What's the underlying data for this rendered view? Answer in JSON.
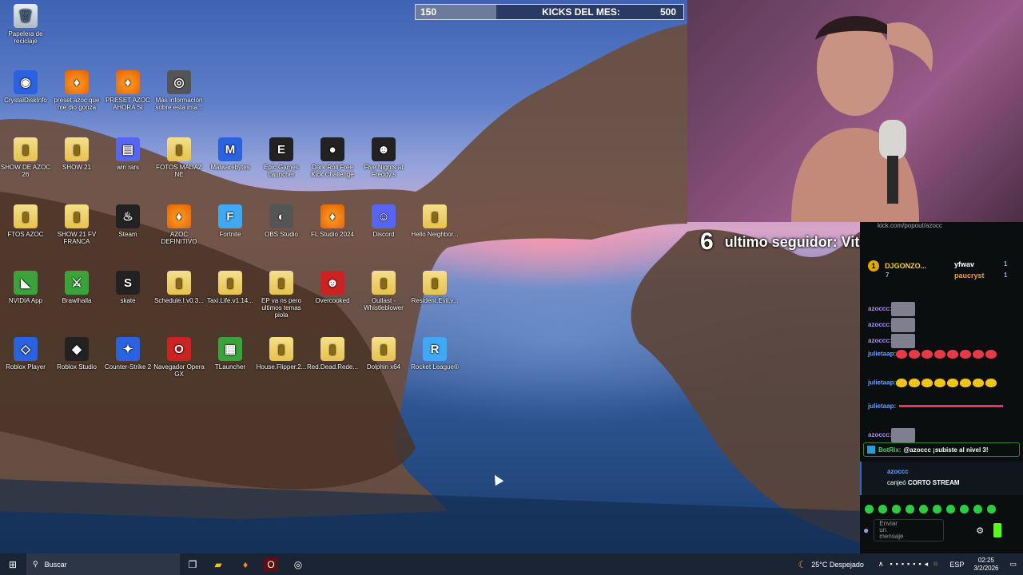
{
  "kicks_bar": {
    "current": "150",
    "label": "KICKS DEL MES:",
    "goal": "500",
    "progress": 0.3
  },
  "desktop_icons": [
    {
      "label": "Papelera de reciclaje",
      "icon": "recycle-bin",
      "glyph": "🗑"
    },
    {
      "label": "CrystalDiskInfo",
      "icon": "crystaldiskinfo",
      "glyph": "◉"
    },
    {
      "label": "preset azoc que me dio gonza",
      "icon": "fl-studio",
      "glyph": "♦"
    },
    {
      "label": "PRESET AZOC AHORA SI",
      "icon": "fl-studio",
      "glyph": "♦"
    },
    {
      "label": "Más información sobre esta ima...",
      "icon": "info",
      "glyph": "◎"
    },
    {
      "label": "SHOW DE AZOC 26",
      "icon": "folder",
      "glyph": "▮"
    },
    {
      "label": "SHOW 21",
      "icon": "folder",
      "glyph": "▮"
    },
    {
      "label": "win rars",
      "icon": "winrar",
      "glyph": "▤"
    },
    {
      "label": "FOTOS MADAZ NE",
      "icon": "folder",
      "glyph": "▮"
    },
    {
      "label": "Malwarebytes",
      "icon": "malwarebytes",
      "glyph": "M"
    },
    {
      "label": "Epic Games Launcher",
      "icon": "epic-games",
      "glyph": "E"
    },
    {
      "label": "Dark Roll Free Kick Challenge",
      "icon": "soccer-ball",
      "glyph": "●"
    },
    {
      "label": "Five Nights at Freddy's",
      "icon": "fnaf",
      "glyph": "☻"
    },
    {
      "label": "FTOS AZOC",
      "icon": "folder",
      "glyph": "▮"
    },
    {
      "label": "SHOW 21 FV FRANCA",
      "icon": "folder",
      "glyph": "▮"
    },
    {
      "label": "Steam",
      "icon": "steam",
      "glyph": "♨"
    },
    {
      "label": "AZOC DEFINITIVO",
      "icon": "fl-studio",
      "glyph": "♦"
    },
    {
      "label": "Fortnite",
      "icon": "fortnite",
      "glyph": "F"
    },
    {
      "label": "OBS Studio",
      "icon": "obs",
      "glyph": "◐"
    },
    {
      "label": "FL Studio 2024",
      "icon": "fl-studio",
      "glyph": "♦"
    },
    {
      "label": "Discord",
      "icon": "discord",
      "glyph": "☺"
    },
    {
      "label": "Hello Neighbor...",
      "icon": "folder",
      "glyph": "▮"
    },
    {
      "label": "NVIDIA App",
      "icon": "nvidia",
      "glyph": "◣"
    },
    {
      "label": "Brawlhalla",
      "icon": "brawlhalla",
      "glyph": "⚔"
    },
    {
      "label": "skate",
      "icon": "skate",
      "glyph": "S"
    },
    {
      "label": "Schedule.I.v0.3...",
      "icon": "folder",
      "glyph": "▮"
    },
    {
      "label": "Taxi.Life.v1.14...",
      "icon": "folder",
      "glyph": "▮"
    },
    {
      "label": "EP va ns pero ultimos temas piola",
      "icon": "folder",
      "glyph": "▮"
    },
    {
      "label": "Overcooked",
      "icon": "overcooked",
      "glyph": "☻"
    },
    {
      "label": "Outlast - Whistleblower",
      "icon": "folder",
      "glyph": "▮"
    },
    {
      "label": "Resident.Evil.v...",
      "icon": "folder",
      "glyph": "▮"
    },
    {
      "label": "Roblox Player",
      "icon": "roblox",
      "glyph": "◇"
    },
    {
      "label": "Roblox Studio",
      "icon": "roblox-studio",
      "glyph": "◆"
    },
    {
      "label": "Counter-Strike 2",
      "icon": "counter-strike",
      "glyph": "✦"
    },
    {
      "label": "Navegador Opera GX",
      "icon": "opera-gx",
      "glyph": "O"
    },
    {
      "label": "TLauncher",
      "icon": "tlauncher",
      "glyph": "▦"
    },
    {
      "label": "House.Flipper.2...",
      "icon": "folder",
      "glyph": "▮"
    },
    {
      "label": "Red.Dead.Rede...",
      "icon": "folder",
      "glyph": "▮"
    },
    {
      "label": "Dolphin x64",
      "icon": "folder",
      "glyph": "▮"
    },
    {
      "label": "Rocket League®",
      "icon": "rocket-league",
      "glyph": "R"
    }
  ],
  "follower_overlay": {
    "count": "6",
    "text": "ultimo seguidor: VitaTheNine"
  },
  "chat": {
    "url": "kick.com/popout/azocc",
    "leaderboard": [
      {
        "rank": "1",
        "name": "DJGONZO...",
        "score": "7"
      },
      {
        "name": "yfwav",
        "score": "1"
      },
      {
        "name": "paucryst",
        "score": "1"
      }
    ],
    "messages": [
      {
        "user": "azoccc:",
        "content": "emote"
      },
      {
        "user": "azoccc:",
        "content": "emote"
      },
      {
        "user": "azoccc:",
        "content": "emote"
      },
      {
        "user": "julietaap:",
        "content": "red-hearts"
      },
      {
        "user": "julietaap:",
        "content": "yellow-emotes"
      },
      {
        "user": "julietaap:",
        "content": "red-line"
      },
      {
        "user": "azoccc:",
        "content": "emote"
      }
    ],
    "botrix": {
      "user": "BotRix:",
      "text": "@azoccc ¡subiste al nivel 3!"
    },
    "redeem": {
      "user": "azoccc",
      "action": "canjeó",
      "reward": "CORTO STREAM"
    },
    "input_placeholder": "Enviar un mensaje"
  },
  "taskbar": {
    "search_placeholder": "Buscar",
    "weather": "25°C Despejado",
    "language": "ESP",
    "time": "02:25",
    "date": "3/2/2026"
  }
}
